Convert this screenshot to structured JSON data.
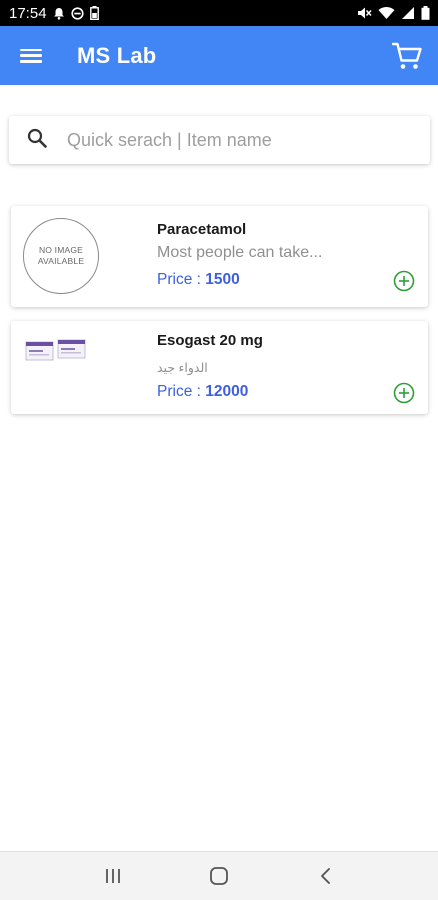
{
  "status_bar": {
    "time": "17:54",
    "icons": [
      "bell-icon",
      "do-not-disturb-icon",
      "battery-saver-icon",
      "mute-icon",
      "wifi-icon",
      "signal-icon",
      "battery-icon"
    ]
  },
  "app_bar": {
    "title": "MS Lab",
    "menu_icon": "hamburger-menu-icon",
    "cart_icon": "shopping-cart-icon"
  },
  "search": {
    "placeholder": "Quick serach | Item name",
    "value": "",
    "icon": "search-icon"
  },
  "items": [
    {
      "name": "Paracetamol",
      "description": "Most people can take...",
      "price_label": "Price :",
      "price": "1500",
      "image_text": [
        "NO IMAGE",
        "AVAILABLE"
      ]
    },
    {
      "name": "Esogast 20 mg",
      "description": "الدواء جيد",
      "price_label": "Price :",
      "price": "12000"
    }
  ],
  "colors": {
    "app_bar": "#4285f4",
    "price": "#3d5fe0",
    "add_button": "#2e9d3a"
  },
  "nav_bar": {
    "icons": [
      "recent-apps-icon",
      "home-icon",
      "back-icon"
    ]
  }
}
